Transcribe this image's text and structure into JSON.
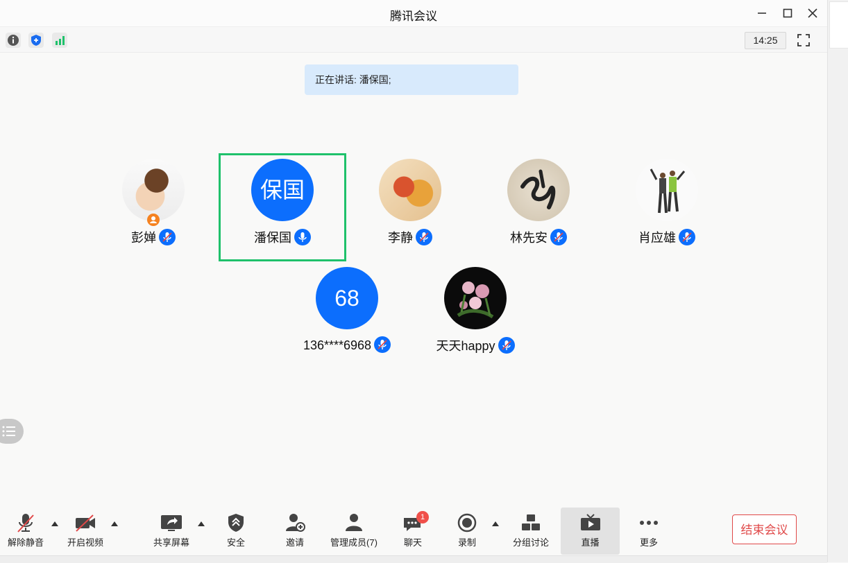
{
  "window": {
    "title": "腾讯会议"
  },
  "infobar": {
    "clock": "14:25"
  },
  "speaking": {
    "text": "正在讲话: 潘保国;"
  },
  "participants": [
    {
      "name": "彭婵",
      "avatar": "photo-child"
    },
    {
      "name": "潘保国",
      "initial": "保国",
      "active": true
    },
    {
      "name": "李静",
      "avatar": "photo-map"
    },
    {
      "name": "林先安",
      "avatar": "photo-calligraphy"
    },
    {
      "name": "肖应雄",
      "avatar": "photo-people"
    },
    {
      "name": "136****6968",
      "initial": "68"
    },
    {
      "name": "天天happy",
      "avatar": "photo-flowers"
    }
  ],
  "toolbar": {
    "unmute": "解除静音",
    "video": "开启视频",
    "share": "共享屏幕",
    "security": "安全",
    "invite": "邀请",
    "members": "管理成员(7)",
    "chat": "聊天",
    "chat_badge": "1",
    "record": "录制",
    "breakout": "分组讨论",
    "live": "直播",
    "more": "更多",
    "end": "结束会议"
  },
  "colors": {
    "accent": "#0c6efd",
    "active_border": "#1fc16b",
    "end": "#e04848"
  }
}
